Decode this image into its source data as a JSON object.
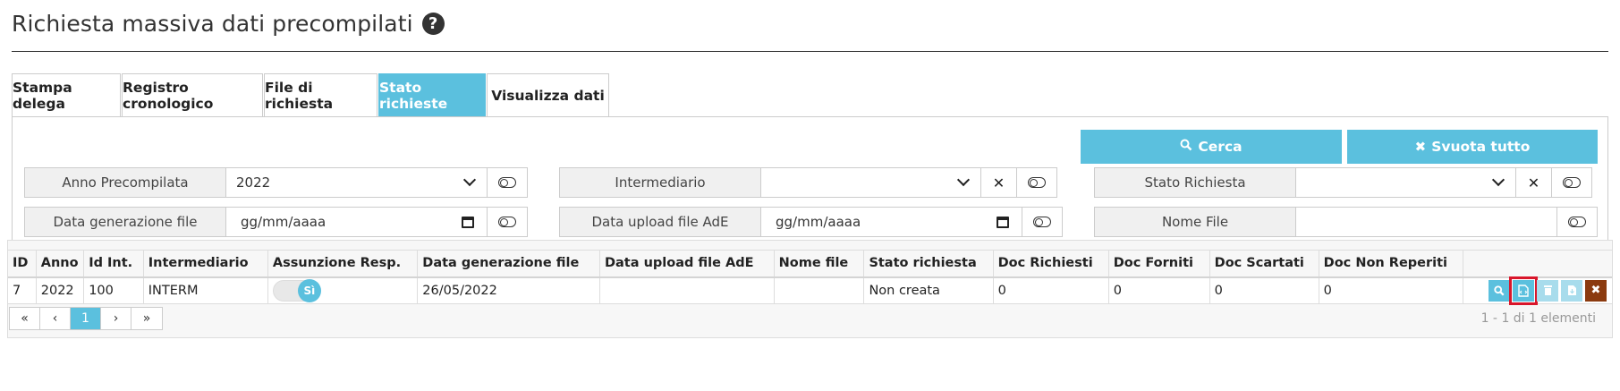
{
  "page": {
    "title": "Richiesta massiva dati precompilati",
    "help_icon": "question-circle-icon"
  },
  "tabs": [
    {
      "label": "Stampa delega",
      "active": false
    },
    {
      "label": "Registro cronologico",
      "active": false
    },
    {
      "label": "File di richiesta",
      "active": false
    },
    {
      "label": "Stato richieste",
      "active": true
    },
    {
      "label": "Visualizza dati",
      "active": false
    }
  ],
  "actions": {
    "search_label": "Cerca",
    "search_icon": "search-icon",
    "clear_label": "Svuota tutto",
    "clear_icon": "times-icon"
  },
  "filters": {
    "anno_precompilata": {
      "label": "Anno Precompilata",
      "value": "2022"
    },
    "intermediario": {
      "label": "Intermediario",
      "value": ""
    },
    "stato_richiesta": {
      "label": "Stato Richiesta",
      "value": ""
    },
    "data_generazione": {
      "label": "Data generazione file",
      "placeholder": "gg/mm/aaaa"
    },
    "data_upload": {
      "label": "Data upload file AdE",
      "placeholder": "gg/mm/aaaa"
    },
    "nome_file": {
      "label": "Nome File",
      "value": ""
    }
  },
  "table": {
    "columns": [
      "ID",
      "Anno",
      "Id Int.",
      "Intermediario",
      "Assunzione Resp.",
      "Data generazione file",
      "Data upload file AdE",
      "Nome file",
      "Stato richiesta",
      "Doc Richiesti",
      "Doc Forniti",
      "Doc Scartati",
      "Doc Non Reperiti",
      ""
    ],
    "rows": [
      {
        "id": "7",
        "anno": "2022",
        "id_int": "100",
        "intermediario": "INTERM",
        "assunzione": "Sì",
        "data_generazione": "26/05/2022",
        "data_upload": "",
        "nome_file": "",
        "stato": "Non creata",
        "doc_richiesti": "0",
        "doc_forniti": "0",
        "doc_scartati": "0",
        "doc_non_reperiti": "0"
      }
    ]
  },
  "pagination": {
    "first": "«",
    "prev": "‹",
    "current": "1",
    "next": "›",
    "last": "»",
    "summary": "1 - 1 di 1 elementi"
  },
  "colors": {
    "accent": "#5bc0de",
    "danger": "#8b3a0f",
    "highlight": "#d9162b"
  }
}
